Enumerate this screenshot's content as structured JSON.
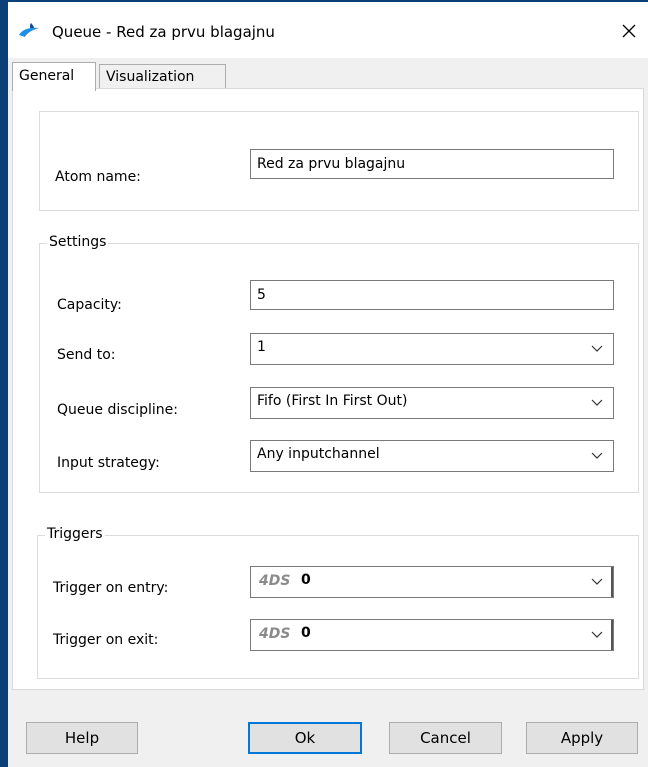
{
  "window": {
    "title": "Queue - Red za prvu blagajnu",
    "app_icon": "4ds-app-icon",
    "close_icon": "close-icon"
  },
  "tabs": [
    {
      "label": "General",
      "selected": true
    },
    {
      "label": "Visualization",
      "selected": false
    }
  ],
  "atom": {
    "label": "Atom name:",
    "value": "Red za prvu blagajnu"
  },
  "settings": {
    "legend": "Settings",
    "capacity": {
      "label": "Capacity:",
      "value": "5"
    },
    "send_to": {
      "label": "Send to:",
      "value": "1"
    },
    "queue_discipline": {
      "label": "Queue discipline:",
      "value": "Fifo (First In First Out)"
    },
    "input_strategy": {
      "label": "Input strategy:",
      "value": "Any inputchannel"
    }
  },
  "triggers": {
    "legend": "Triggers",
    "on_entry": {
      "label": "Trigger on entry:",
      "tag": "4DS",
      "value": "0"
    },
    "on_exit": {
      "label": "Trigger on exit:",
      "tag": "4DS",
      "value": "0"
    }
  },
  "buttons": {
    "help": "Help",
    "ok": "Ok",
    "cancel": "Cancel",
    "apply": "Apply"
  },
  "colors": {
    "window_border": "#0a3f78",
    "dialog_bg": "#f0f0f0",
    "focus_accent": "#0078d7",
    "icon_blue": "#1e90e8"
  }
}
